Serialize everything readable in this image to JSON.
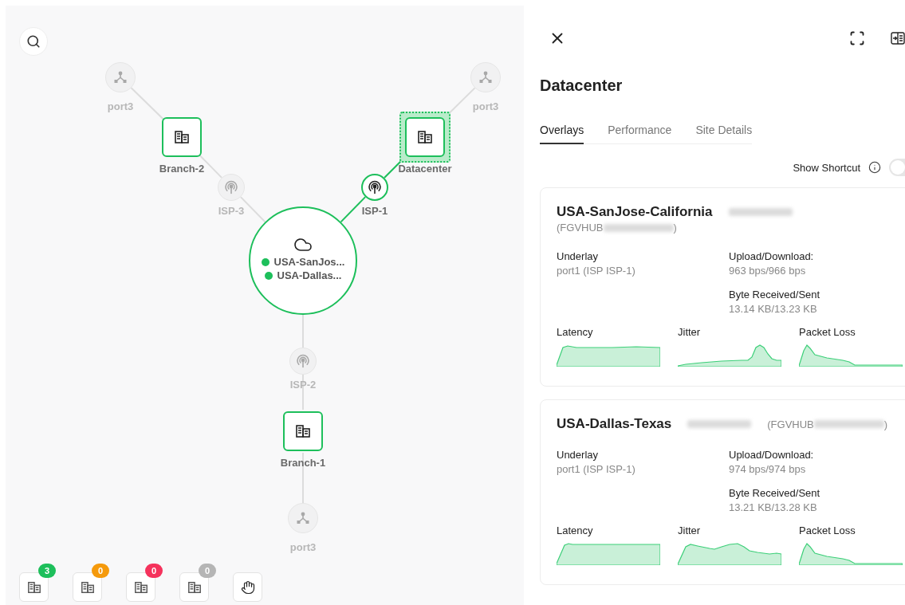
{
  "canvas": {
    "nodes": [
      {
        "kind": "port",
        "label": "port3",
        "active": false,
        "selected": false
      },
      {
        "kind": "site",
        "label": "Branch-2",
        "active": true,
        "selected": false
      },
      {
        "kind": "isp",
        "label": "ISP-3",
        "active": false,
        "selected": false
      },
      {
        "kind": "hub",
        "active": true,
        "selected": false,
        "members": [
          {
            "label": "USA-SanJos...",
            "color": "#1dbf5b"
          },
          {
            "label": "USA-Dallas...",
            "color": "#1dbf5b"
          }
        ]
      },
      {
        "kind": "isp",
        "label": "ISP-1",
        "active": true,
        "selected": false
      },
      {
        "kind": "site",
        "label": "Datacenter",
        "active": true,
        "selected": true
      },
      {
        "kind": "port",
        "label": "port3",
        "active": false,
        "selected": false
      },
      {
        "kind": "isp",
        "label": "ISP-2",
        "active": false,
        "selected": false
      },
      {
        "kind": "site",
        "label": "Branch-1",
        "active": true,
        "selected": false
      },
      {
        "kind": "port",
        "label": "port3",
        "active": false,
        "selected": false
      }
    ],
    "links": [
      {
        "active": false
      },
      {
        "active": false
      },
      {
        "active": false
      },
      {
        "active": true
      },
      {
        "active": true
      },
      {
        "active": false
      },
      {
        "active": false
      },
      {
        "active": false
      },
      {
        "active": false
      }
    ],
    "filters": [
      {
        "count": "3",
        "color": "#1dbf5b"
      },
      {
        "count": "0",
        "color": "#f59a0c"
      },
      {
        "count": "0",
        "color": "#f5325c"
      },
      {
        "count": "0",
        "color": "#b5b5b5"
      }
    ]
  },
  "panel": {
    "title": "Datacenter",
    "tabs": [
      {
        "label": "Overlays",
        "selected": true
      },
      {
        "label": "Performance",
        "selected": false
      },
      {
        "label": "Site Details",
        "selected": false
      }
    ],
    "shortcut": {
      "label": "Show Shortcut",
      "on": false
    },
    "overlays": [
      {
        "name": "USA-SanJose-California",
        "serial_prefix": "(FGVHUB",
        "serial_suffix": ")",
        "underlay_label": "Underlay",
        "underlay": "port1 (ISP ISP-1)",
        "rate_label": "Upload/Download:",
        "rate": "963 bps/966 bps",
        "bytes_label": "Byte Received/Sent",
        "bytes": "13.14 KB/13.23 KB",
        "metrics": [
          "Latency",
          "Jitter",
          "Packet Loss"
        ]
      },
      {
        "name": "USA-Dallas-Texas",
        "serial_prefix": "(FGVHUB",
        "serial_suffix": ")",
        "underlay_label": "Underlay",
        "underlay": "port1 (ISP ISP-1)",
        "rate_label": "Upload/Download:",
        "rate": "974 bps/974 bps",
        "bytes_label": "Byte Received/Sent",
        "bytes": "13.21 KB/13.28 KB",
        "metrics": [
          "Latency",
          "Jitter",
          "Packet Loss"
        ]
      }
    ]
  }
}
